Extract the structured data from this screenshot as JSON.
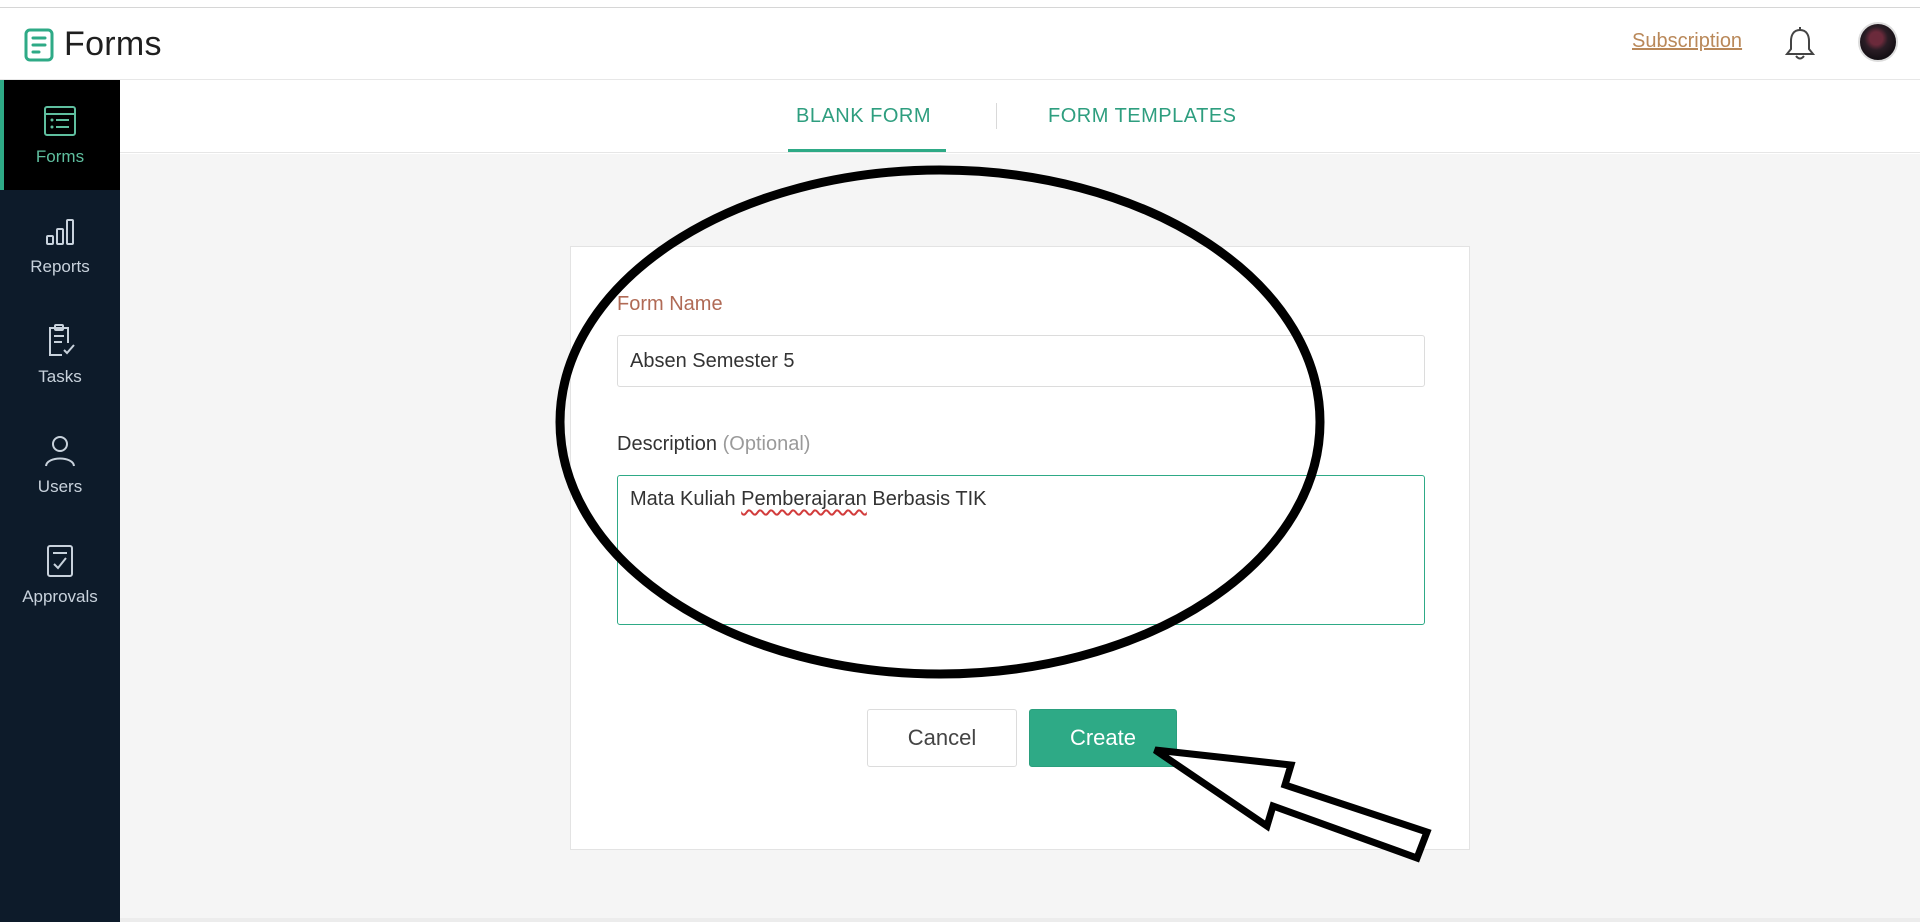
{
  "header": {
    "app_title": "Forms",
    "subscription_link": "Subscription",
    "icons": [
      "forms-logo-icon",
      "bell-icon",
      "avatar"
    ]
  },
  "sidebar": {
    "items": [
      {
        "label": "Forms",
        "icon": "form-list-icon",
        "active": true
      },
      {
        "label": "Reports",
        "icon": "bar-chart-icon",
        "active": false
      },
      {
        "label": "Tasks",
        "icon": "clipboard-check-icon",
        "active": false
      },
      {
        "label": "Users",
        "icon": "user-icon",
        "active": false
      },
      {
        "label": "Approvals",
        "icon": "approval-document-icon",
        "active": false
      }
    ]
  },
  "tabs": {
    "blank": "BLANK FORM",
    "templates": "FORM TEMPLATES",
    "active": "blank"
  },
  "form": {
    "name_label": "Form Name",
    "name_value": "Absen Semester 5",
    "description_label": "Description",
    "description_optional": "(Optional)",
    "description_value_before": "Mata Kuliah ",
    "description_value_misspelled": "Pemberajaran",
    "description_value_after": " Berbasis TIK"
  },
  "buttons": {
    "cancel": "Cancel",
    "create": "Create"
  },
  "colors": {
    "accent": "#2eaa86",
    "sidebar_bg": "#0d1b2a",
    "subscription": "#b98859",
    "form_name_label": "#b06a55"
  }
}
